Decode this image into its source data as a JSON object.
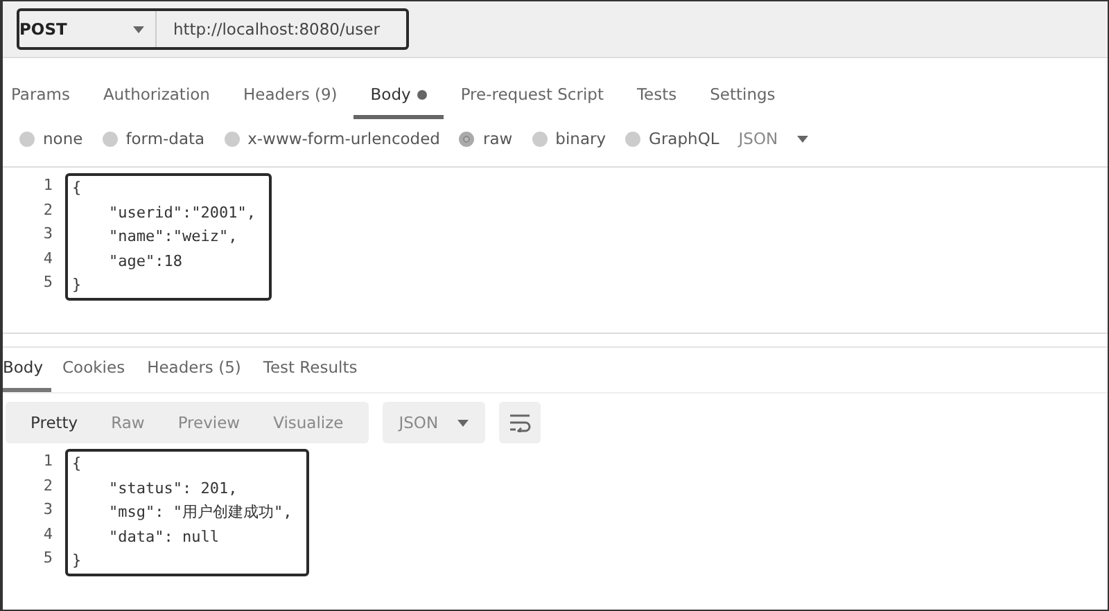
{
  "request": {
    "method": "POST",
    "url": "http://localhost:8080/user",
    "highlighted": true
  },
  "request_tabs": [
    {
      "label": "Params",
      "selected": false,
      "dot": false
    },
    {
      "label": "Authorization",
      "selected": false,
      "dot": false
    },
    {
      "label": "Headers (9)",
      "selected": false,
      "dot": false
    },
    {
      "label": "Body",
      "selected": true,
      "dot": true
    },
    {
      "label": "Pre-request Script",
      "selected": false,
      "dot": false
    },
    {
      "label": "Tests",
      "selected": false,
      "dot": false
    },
    {
      "label": "Settings",
      "selected": false,
      "dot": false
    }
  ],
  "body_types": [
    {
      "label": "none",
      "selected": false
    },
    {
      "label": "form-data",
      "selected": false
    },
    {
      "label": "x-www-form-urlencoded",
      "selected": false
    },
    {
      "label": "raw",
      "selected": true
    },
    {
      "label": "binary",
      "selected": false
    },
    {
      "label": "GraphQL",
      "selected": false
    }
  ],
  "body_format": "JSON",
  "request_body": {
    "highlighted": true,
    "lines": [
      {
        "number": "1",
        "text": "{"
      },
      {
        "number": "2",
        "text": "    \"userid\":\"2001\","
      },
      {
        "number": "3",
        "text": "    \"name\":\"weiz\","
      },
      {
        "number": "4",
        "text": "    \"age\":18"
      },
      {
        "number": "5",
        "text": "}"
      }
    ]
  },
  "response_tabs": [
    {
      "label": "Body",
      "selected": true
    },
    {
      "label": "Cookies",
      "selected": false
    },
    {
      "label": "Headers (5)",
      "selected": false
    },
    {
      "label": "Test Results",
      "selected": false
    }
  ],
  "view_modes": [
    {
      "label": "Pretty",
      "selected": true
    },
    {
      "label": "Raw",
      "selected": false
    },
    {
      "label": "Preview",
      "selected": false
    },
    {
      "label": "Visualize",
      "selected": false
    }
  ],
  "response_format": "JSON",
  "response_body": {
    "highlighted": true,
    "lines": [
      {
        "number": "1",
        "text": "{"
      },
      {
        "number": "2",
        "text": "    \"status\": 201,"
      },
      {
        "number": "3",
        "text": "    \"msg\": \"用户创建成功\","
      },
      {
        "number": "4",
        "text": "    \"data\": null"
      },
      {
        "number": "5",
        "text": "}"
      }
    ]
  }
}
